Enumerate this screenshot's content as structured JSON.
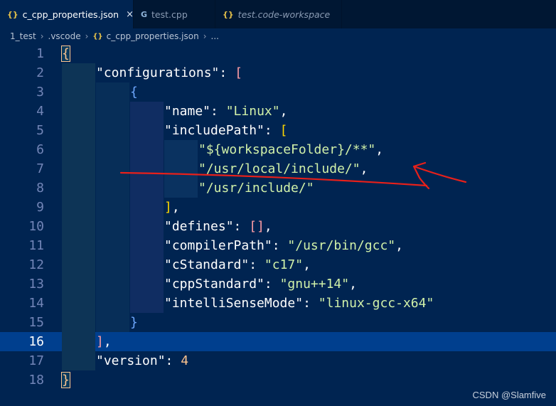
{
  "tabs": [
    {
      "icon": "{}",
      "label": "c_cpp_properties.json",
      "close": "×"
    },
    {
      "icon": "G",
      "label": "test.cpp"
    },
    {
      "icon": "{}",
      "label": "test.code-workspace"
    }
  ],
  "breadcrumb": {
    "items": [
      "1_test",
      ".vscode",
      "c_cpp_properties.json",
      "..."
    ],
    "sep": "›",
    "file_icon": "{}"
  },
  "lines": [
    {
      "n": "1",
      "t1": "{"
    },
    {
      "n": "2",
      "k": "\"configurations\"",
      "p": ": ",
      "b": "["
    },
    {
      "n": "3",
      "b": "{"
    },
    {
      "n": "4",
      "k": "\"name\"",
      "p": ": ",
      "s": "\"Linux\"",
      "e": ","
    },
    {
      "n": "5",
      "k": "\"includePath\"",
      "p": ": ",
      "b": "["
    },
    {
      "n": "6",
      "s": "\"${workspaceFolder}/**\"",
      "e": ","
    },
    {
      "n": "7",
      "s": "\"/usr/local/include/\"",
      "e": ","
    },
    {
      "n": "8",
      "s": "\"/usr/include/\""
    },
    {
      "n": "9",
      "b": "]",
      "e": ","
    },
    {
      "n": "10",
      "k": "\"defines\"",
      "p": ": ",
      "b": "[]",
      "e": ","
    },
    {
      "n": "11",
      "k": "\"compilerPath\"",
      "p": ": ",
      "s": "\"/usr/bin/gcc\"",
      "e": ","
    },
    {
      "n": "12",
      "k": "\"cStandard\"",
      "p": ": ",
      "s": "\"c17\"",
      "e": ","
    },
    {
      "n": "13",
      "k": "\"cppStandard\"",
      "p": ": ",
      "s": "\"gnu++14\"",
      "e": ","
    },
    {
      "n": "14",
      "k": "\"intelliSenseMode\"",
      "p": ": ",
      "s": "\"linux-gcc-x64\""
    },
    {
      "n": "15",
      "b": "}"
    },
    {
      "n": "16",
      "b": "]",
      "e": ","
    },
    {
      "n": "17",
      "k": "\"version\"",
      "p": ": ",
      "num": "4"
    },
    {
      "n": "18",
      "t1": "}"
    }
  ],
  "annotation_color": "#e8201a",
  "watermark": "CSDN @Slamfive"
}
